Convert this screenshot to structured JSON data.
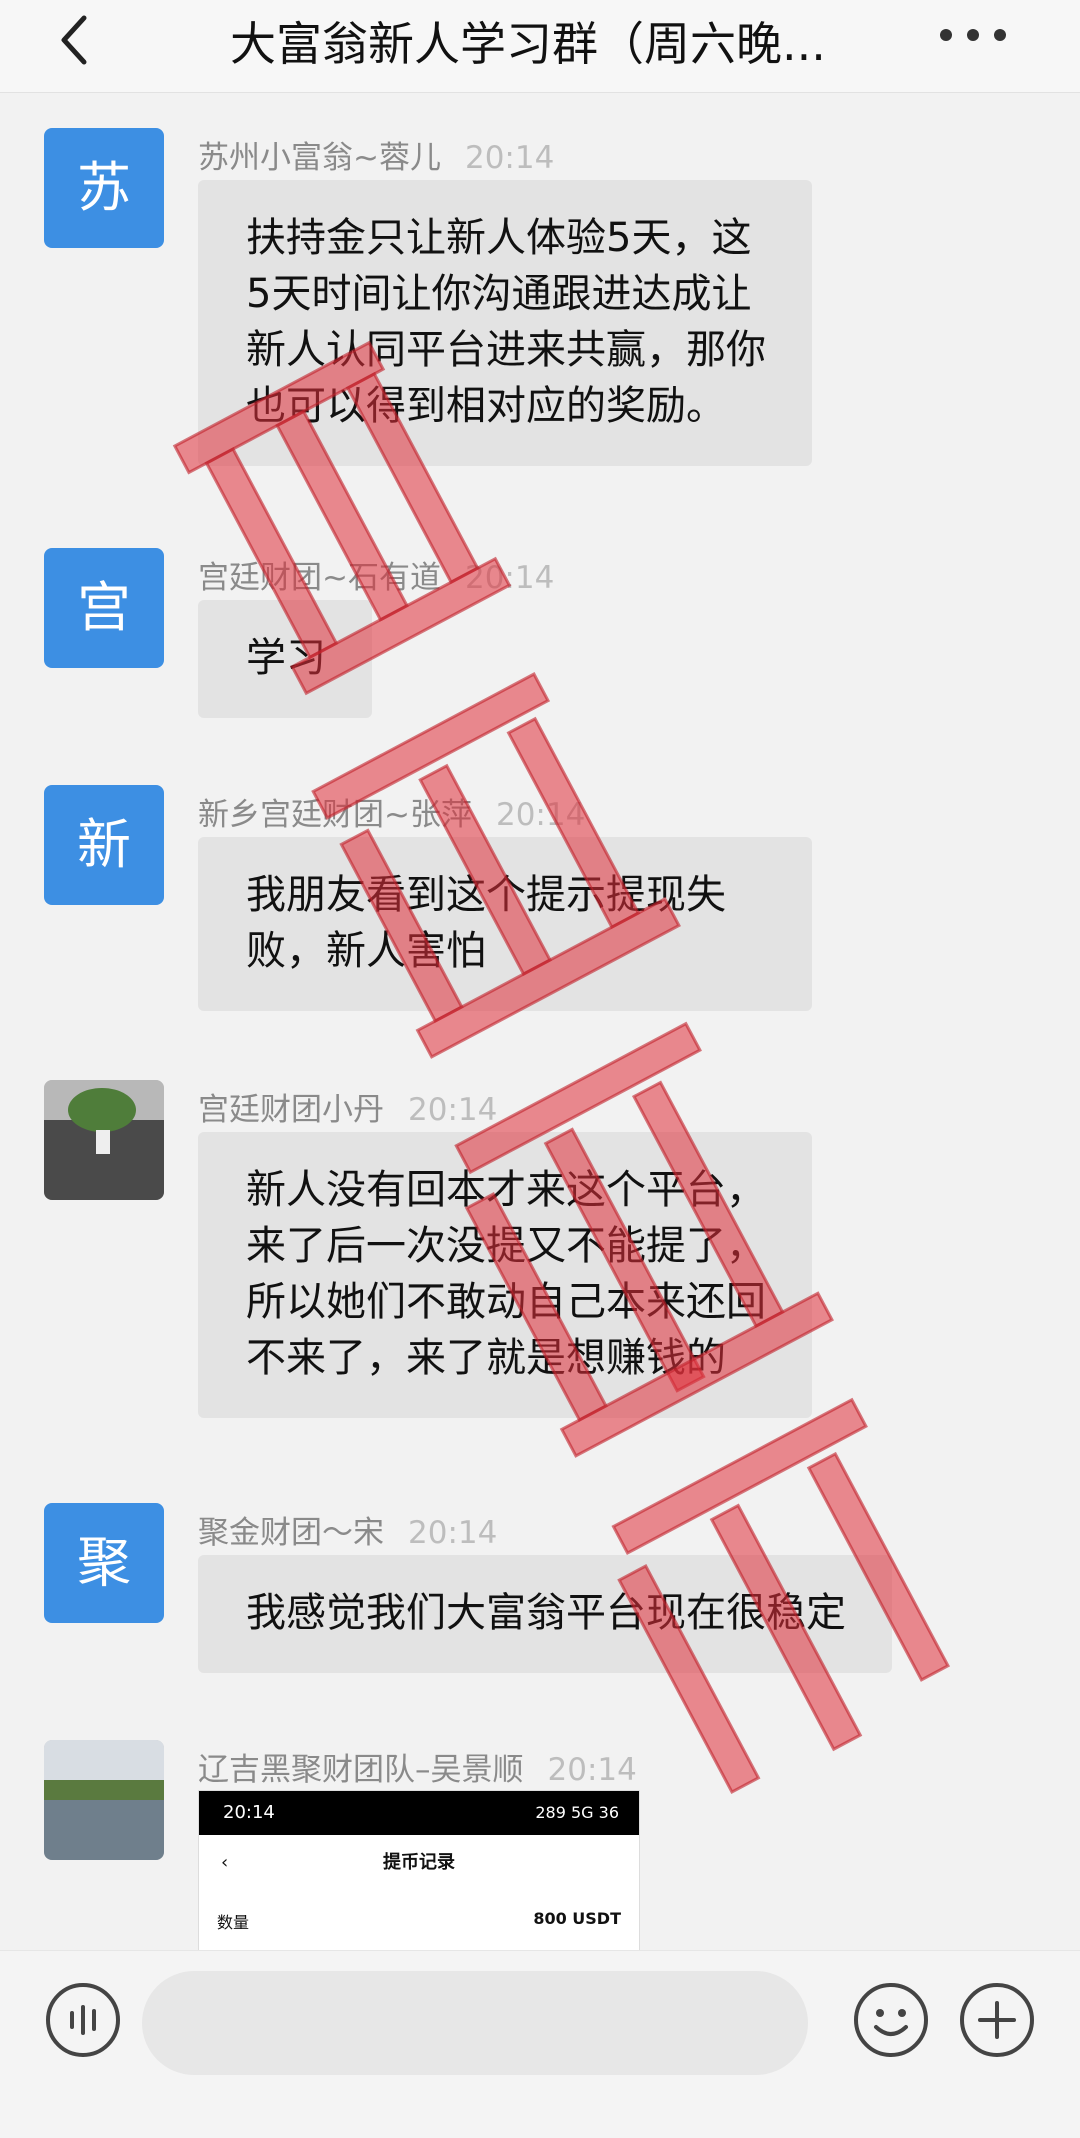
{
  "header": {
    "title": "大富翁新人学习群（周六晚...",
    "back_icon": "chevron-left-icon",
    "more_icon": "more-dots-icon"
  },
  "messages": [
    {
      "sender": "苏州小富翁~蓉儿",
      "time": "20:14",
      "avatar_text": "苏",
      "text": "扶持金只让新人体验5天，这5天时间让你沟通跟进达成让新人认同平台进来共赢，那你也可以得到相对应的奖励。"
    },
    {
      "sender": "宫廷财团~石有道",
      "time": "20:14",
      "avatar_text": "宫",
      "text": "学习"
    },
    {
      "sender": "新乡宫廷财团~张萍",
      "time": "20:14",
      "avatar_text": "新",
      "text": "我朋友看到这个提示提现失败，新人害怕"
    },
    {
      "sender": "宫廷财团小丹",
      "time": "20:14",
      "avatar_text": "",
      "text": "新人没有回本才来这个平台，来了后一次没提又不能提了，所以她们不敢动自己本来还回不来了，来了就是想赚钱的"
    },
    {
      "sender": "聚金财团～宋",
      "time": "20:14",
      "avatar_text": "聚",
      "text": "我感觉我们大富翁平台现在很稳定"
    },
    {
      "sender": "辽吉黑聚财团队–吴景顺",
      "time": "20:14",
      "avatar_text": ""
    }
  ],
  "embedded_screenshot": {
    "status_time": "20:14",
    "status_right": "289 5G 36",
    "nav_title": "提币记录",
    "row_label": "数量",
    "row_value": "800 USDT"
  },
  "watermark_text": "大富翁骗局",
  "colors": {
    "avatar_blue": "#3d8fe3",
    "bubble": "#e3e3e3",
    "watermark": "#e0303a"
  }
}
